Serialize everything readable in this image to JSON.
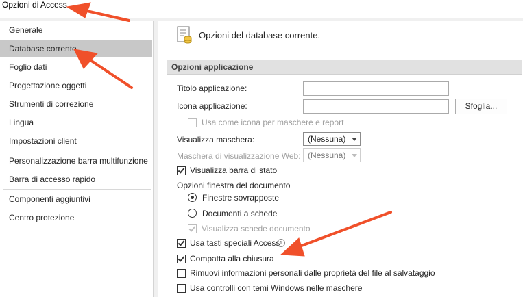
{
  "window": {
    "title": "Opzioni di Access"
  },
  "nav": {
    "items": [
      {
        "label": "Generale"
      },
      {
        "label": "Database corrente"
      },
      {
        "label": "Foglio dati"
      },
      {
        "label": "Progettazione oggetti"
      },
      {
        "label": "Strumenti di correzione"
      },
      {
        "label": "Lingua"
      },
      {
        "label": "Impostazioni client"
      },
      {
        "label": "Personalizzazione barra multifunzione"
      },
      {
        "label": "Barra di accesso rapido"
      },
      {
        "label": "Componenti aggiuntivi"
      },
      {
        "label": "Centro protezione"
      }
    ],
    "selected": "Database corrente"
  },
  "main": {
    "header": "Opzioni del database corrente.",
    "section_title": "Opzioni applicazione",
    "app_title_label": "Titolo applicazione:",
    "app_title_value": "",
    "app_icon_label": "Icona applicazione:",
    "app_icon_value": "",
    "browse_label": "Sfoglia...",
    "use_icon_label": "Usa come icona per maschere e report",
    "display_form_label": "Visualizza maschera:",
    "display_form_value": "(Nessuna)",
    "web_form_label": "Maschera di visualizzazione Web:",
    "web_form_value": "(Nessuna)",
    "status_bar_label": "Visualizza barra di stato",
    "doc_window_label": "Opzioni finestra del documento",
    "overlapping_label": "Finestre sovrapposte",
    "tabbed_label": "Documenti a schede",
    "doc_tabs_label": "Visualizza schede documento",
    "special_keys_label": "Usa tasti speciali Access",
    "compact_label": "Compatta alla chiusura",
    "remove_info_label": "Rimuovi informazioni personali dalle proprietà del file al salvataggio",
    "themed_controls_label": "Usa controlli con temi Windows nelle maschere",
    "info_glyph": "i"
  },
  "state": {
    "use_icon_checked": false,
    "status_bar_checked": true,
    "window_mode": "Finestre sovrapposte",
    "doc_tabs_checked": true,
    "special_keys_checked": true,
    "compact_checked": true,
    "remove_info_checked": false,
    "themed_controls_checked": false
  },
  "colors": {
    "selected_nav": "#c8c8c8",
    "section_band": "#e1e1e1",
    "annotation_arrow": "#f0502a"
  },
  "icons": {
    "header": "database-options-icon",
    "info": "info-icon"
  }
}
